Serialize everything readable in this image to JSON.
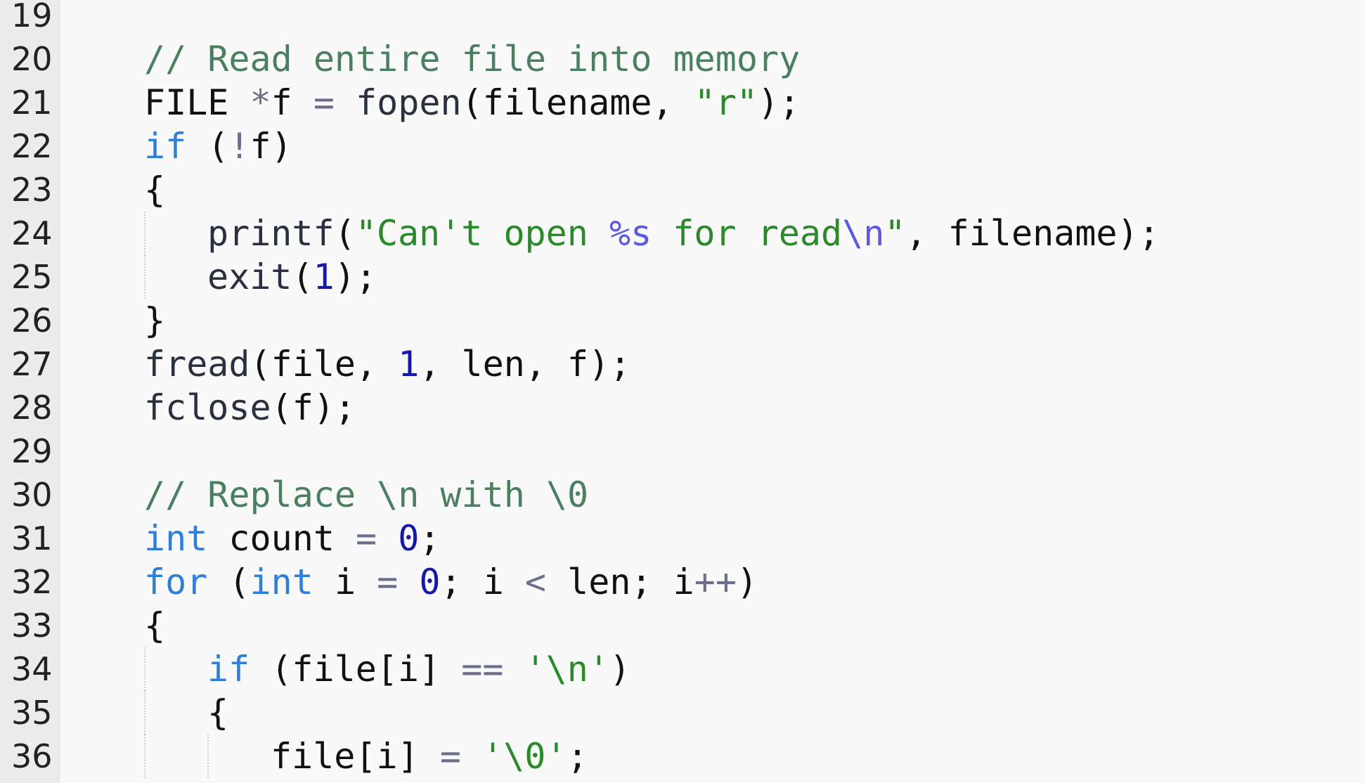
{
  "editor": {
    "lines": [
      {
        "number": "19",
        "indent": 0,
        "tokens": []
      },
      {
        "number": "20",
        "indent": 1,
        "tokens": [
          {
            "type": "comment",
            "text": "// Read entire file into memory"
          }
        ]
      },
      {
        "number": "21",
        "indent": 1,
        "tokens": [
          {
            "type": "plain",
            "text": "FILE "
          },
          {
            "type": "op",
            "text": "*"
          },
          {
            "type": "plain",
            "text": "f "
          },
          {
            "type": "op",
            "text": "="
          },
          {
            "type": "plain",
            "text": " "
          },
          {
            "type": "func",
            "text": "fopen"
          },
          {
            "type": "plain",
            "text": "(filename, "
          },
          {
            "type": "string",
            "text": "\"r\""
          },
          {
            "type": "plain",
            "text": ");"
          }
        ]
      },
      {
        "number": "22",
        "indent": 1,
        "tokens": [
          {
            "type": "keyword",
            "text": "if"
          },
          {
            "type": "plain",
            "text": " ("
          },
          {
            "type": "op",
            "text": "!"
          },
          {
            "type": "plain",
            "text": "f)"
          }
        ]
      },
      {
        "number": "23",
        "indent": 1,
        "tokens": [
          {
            "type": "plain",
            "text": "{"
          }
        ]
      },
      {
        "number": "24",
        "indent": 2,
        "tokens": [
          {
            "type": "func",
            "text": "printf"
          },
          {
            "type": "plain",
            "text": "("
          },
          {
            "type": "string",
            "text": "\"Can't open "
          },
          {
            "type": "escape",
            "text": "%s"
          },
          {
            "type": "string",
            "text": " for read"
          },
          {
            "type": "escape",
            "text": "\\n"
          },
          {
            "type": "string",
            "text": "\""
          },
          {
            "type": "plain",
            "text": ", filename);"
          }
        ]
      },
      {
        "number": "25",
        "indent": 2,
        "tokens": [
          {
            "type": "func",
            "text": "exit"
          },
          {
            "type": "plain",
            "text": "("
          },
          {
            "type": "number",
            "text": "1"
          },
          {
            "type": "plain",
            "text": ");"
          }
        ]
      },
      {
        "number": "26",
        "indent": 1,
        "tokens": [
          {
            "type": "plain",
            "text": "}"
          }
        ]
      },
      {
        "number": "27",
        "indent": 1,
        "tokens": [
          {
            "type": "func",
            "text": "fread"
          },
          {
            "type": "plain",
            "text": "(file, "
          },
          {
            "type": "number",
            "text": "1"
          },
          {
            "type": "plain",
            "text": ", len, f);"
          }
        ]
      },
      {
        "number": "28",
        "indent": 1,
        "tokens": [
          {
            "type": "func",
            "text": "fclose"
          },
          {
            "type": "plain",
            "text": "(f);"
          }
        ]
      },
      {
        "number": "29",
        "indent": 0,
        "tokens": []
      },
      {
        "number": "30",
        "indent": 1,
        "tokens": [
          {
            "type": "comment",
            "text": "// Replace \\n with \\0"
          }
        ]
      },
      {
        "number": "31",
        "indent": 1,
        "tokens": [
          {
            "type": "keyword",
            "text": "int"
          },
          {
            "type": "plain",
            "text": " count "
          },
          {
            "type": "op",
            "text": "="
          },
          {
            "type": "plain",
            "text": " "
          },
          {
            "type": "number",
            "text": "0"
          },
          {
            "type": "plain",
            "text": ";"
          }
        ]
      },
      {
        "number": "32",
        "indent": 1,
        "tokens": [
          {
            "type": "keyword",
            "text": "for"
          },
          {
            "type": "plain",
            "text": " ("
          },
          {
            "type": "keyword",
            "text": "int"
          },
          {
            "type": "plain",
            "text": " i "
          },
          {
            "type": "op",
            "text": "="
          },
          {
            "type": "plain",
            "text": " "
          },
          {
            "type": "number",
            "text": "0"
          },
          {
            "type": "plain",
            "text": "; i "
          },
          {
            "type": "op",
            "text": "<"
          },
          {
            "type": "plain",
            "text": " len; i"
          },
          {
            "type": "op",
            "text": "++"
          },
          {
            "type": "plain",
            "text": ")"
          }
        ]
      },
      {
        "number": "33",
        "indent": 1,
        "tokens": [
          {
            "type": "plain",
            "text": "{"
          }
        ]
      },
      {
        "number": "34",
        "indent": 2,
        "tokens": [
          {
            "type": "keyword",
            "text": "if"
          },
          {
            "type": "plain",
            "text": " (file[i] "
          },
          {
            "type": "op",
            "text": "=="
          },
          {
            "type": "plain",
            "text": " "
          },
          {
            "type": "string",
            "text": "'\\n'"
          },
          {
            "type": "plain",
            "text": ")"
          }
        ]
      },
      {
        "number": "35",
        "indent": 2,
        "tokens": [
          {
            "type": "plain",
            "text": "{"
          }
        ]
      },
      {
        "number": "36",
        "indent": 3,
        "tokens": [
          {
            "type": "plain",
            "text": "file[i] "
          },
          {
            "type": "op",
            "text": "="
          },
          {
            "type": "plain",
            "text": " "
          },
          {
            "type": "string",
            "text": "'\\0'"
          },
          {
            "type": "plain",
            "text": ";"
          }
        ]
      }
    ],
    "guides": [
      {
        "from": "24",
        "to": "25",
        "level": 1
      },
      {
        "from": "34",
        "to": "36",
        "level": 1
      },
      {
        "from": "36",
        "to": "36",
        "level": 2
      }
    ],
    "colors": {
      "background": "#f9f9f9",
      "gutter": "#ececec",
      "comment": "#4a7f5f",
      "keyword": "#2f7fd6",
      "number": "#1717a8",
      "string": "#2a8a2a",
      "escape": "#5a5ae0"
    }
  }
}
